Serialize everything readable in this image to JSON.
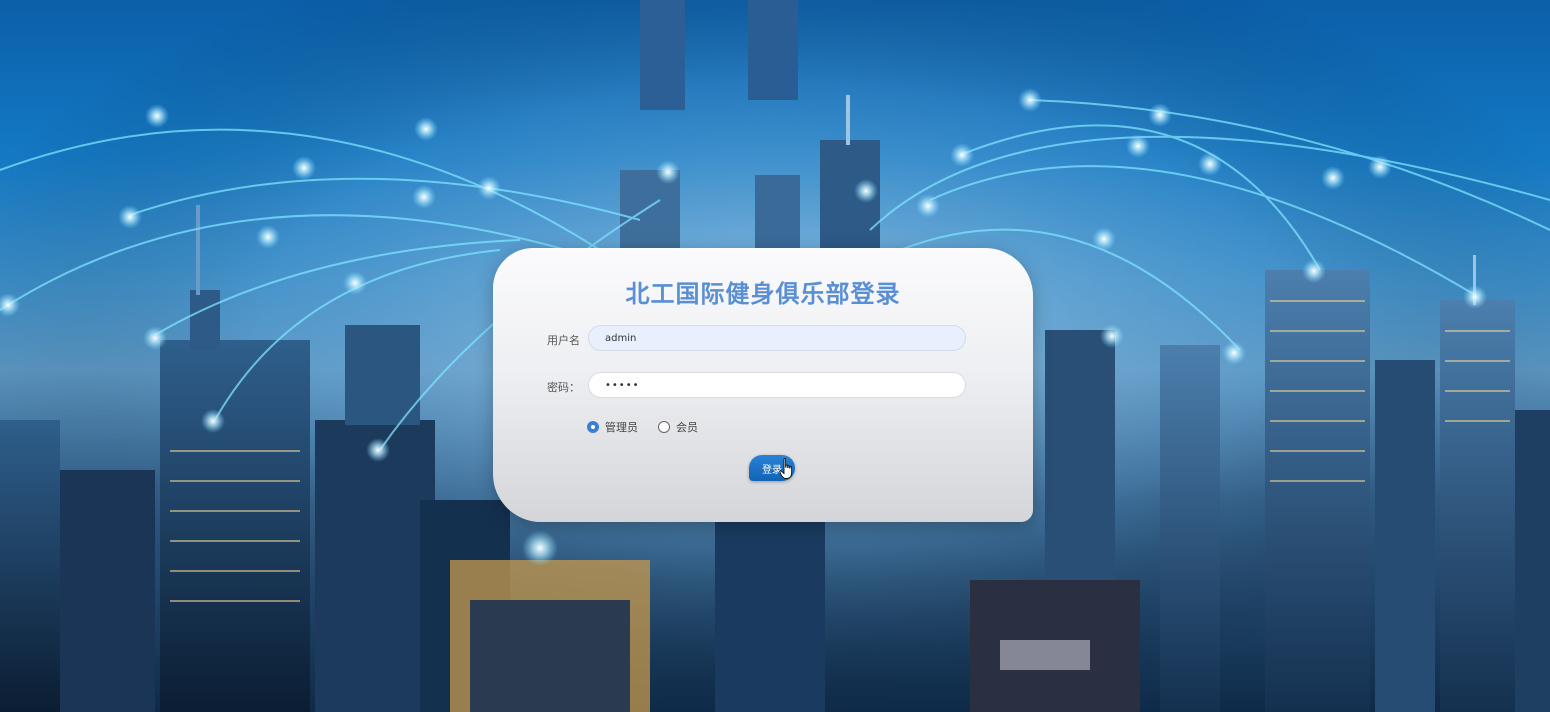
{
  "login": {
    "title": "北工国际健身俱乐部登录",
    "username_label": "用户名",
    "username_value": "admin",
    "password_label": "密码：",
    "password_value": "•••••",
    "roles": [
      {
        "label": "管理员",
        "checked": true
      },
      {
        "label": "会员",
        "checked": false
      }
    ],
    "submit_label": "登录"
  },
  "colors": {
    "title": "#5b8fd4",
    "button": "#1a6fc4",
    "radio_selected": "#3a7fd5"
  }
}
